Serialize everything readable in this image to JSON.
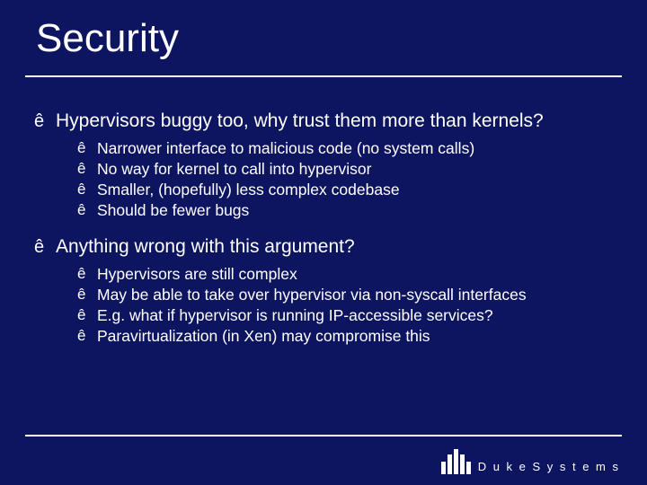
{
  "title": "Security",
  "bullet_glyph": "ê",
  "items": [
    {
      "level": 1,
      "text": "Hypervisors buggy too, why trust them more than kernels?",
      "sub": [
        "Narrower interface to malicious code (no system calls)",
        "No way for kernel to call into hypervisor",
        "Smaller, (hopefully) less complex codebase",
        "Should be fewer bugs"
      ]
    },
    {
      "level": 1,
      "text": "Anything wrong with this argument?",
      "sub": [
        "Hypervisors are still complex",
        "May be able to take over hypervisor via non-syscall interfaces",
        "E.g. what if hypervisor is running IP-accessible services?",
        "Paravirtualization (in Xen) may compromise this"
      ]
    }
  ],
  "footer": {
    "logo_text": "D u k e   S y s t e m s"
  }
}
